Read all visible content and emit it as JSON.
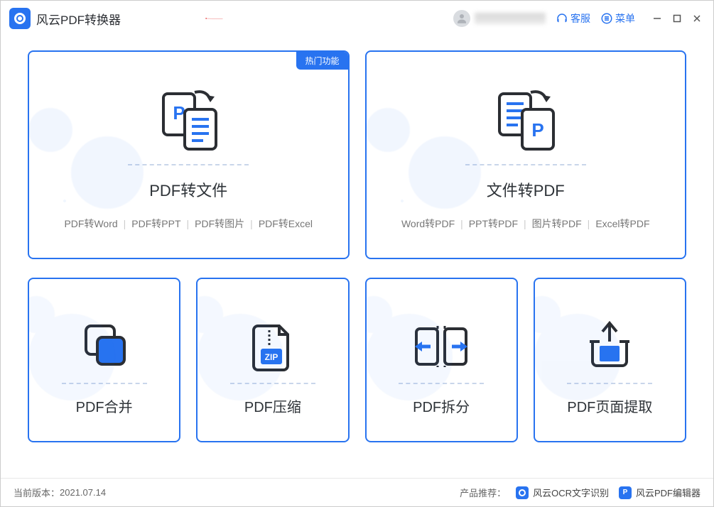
{
  "app": {
    "title": "风云PDF转换器"
  },
  "titlebar": {
    "support": "客服",
    "menu": "菜单"
  },
  "cards": {
    "hot_badge": "热门功能",
    "pdf_to_file": {
      "title": "PDF转文件",
      "subs": [
        "PDF转Word",
        "PDF转PPT",
        "PDF转图片",
        "PDF转Excel"
      ]
    },
    "file_to_pdf": {
      "title": "文件转PDF",
      "subs": [
        "Word转PDF",
        "PPT转PDF",
        "图片转PDF",
        "Excel转PDF"
      ]
    },
    "merge": "PDF合并",
    "compress": "PDF压缩",
    "split": "PDF拆分",
    "extract": "PDF页面提取"
  },
  "footer": {
    "version_label": "当前版本：",
    "version_value": "2021.07.14",
    "recommend_label": "产品推荐：",
    "ocr": "风云OCR文字识别",
    "editor": "风云PDF编辑器"
  }
}
